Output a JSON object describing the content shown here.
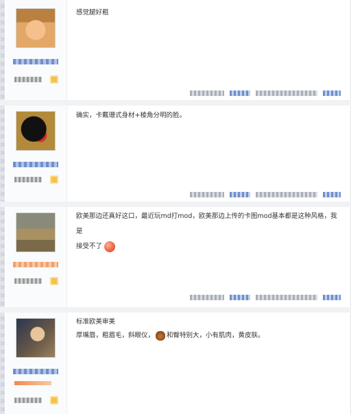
{
  "posts": [
    {
      "text": "感觉腿好粗",
      "line2": ""
    },
    {
      "text": "确实，卡戴珊式身材+棱角分明的脸。",
      "line2": ""
    },
    {
      "text": "欧美那边还真好这口，最近玩md打mod，欧美那边上传的卡图mod基本都是这种风格，我是",
      "line2": "接受不了"
    },
    {
      "text": "标准欧美审美",
      "line2a": "厚嘴唇，粗眉毛，斜眼仪，",
      "line2b": "和臀特别大，小有肌肉，黄皮肤。"
    }
  ],
  "icons": {
    "emoji_face": "angry-face-emoji-icon",
    "emoji_bear": "bear-emoji-icon",
    "level_badge": "level-badge-icon"
  },
  "colors": {
    "link_blue": "#6f8fcc",
    "badge_gold": "#f5c04f",
    "emoji_red": "#e5573c"
  }
}
